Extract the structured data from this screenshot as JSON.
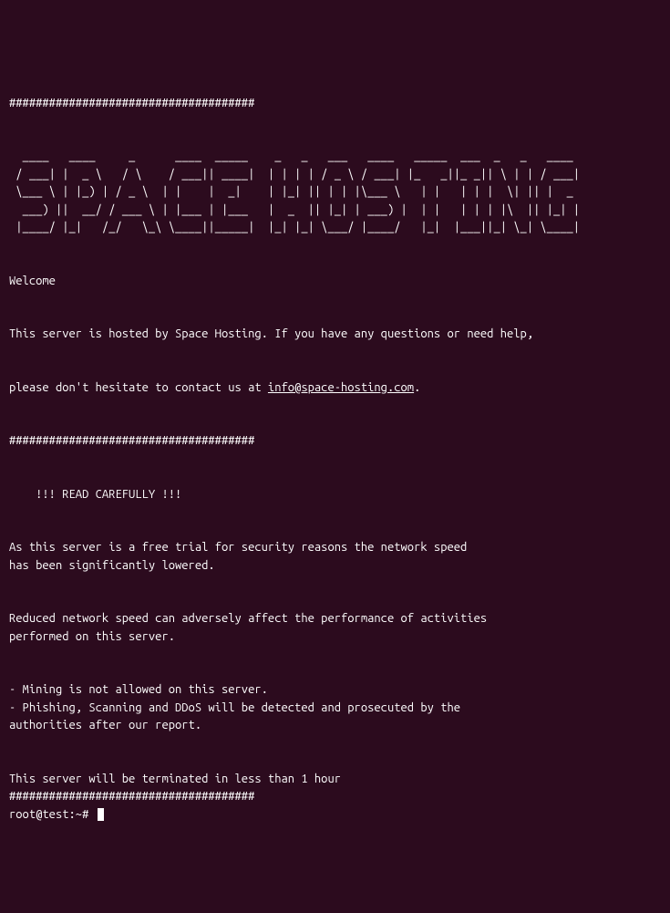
{
  "border_top": "#####################################",
  "ascii_art": "  ____   ____     _      ____  _____    _   _   ___   ____   _____  ___  _   _   ____\n / ___| |  _ \\   / \\    / ___|| ____|  | | | | / _ \\ / ___| |_   _||_ _|| \\ | | / ___|\n \\___ \\ | |_) | / _ \\  | |    |  _|    | |_| || | | |\\___ \\   | |   | | |  \\| || |  _\n  ___) ||  __/ / ___ \\ | |___ | |___   |  _  || |_| | ___) |  | |   | | | |\\  || |_| |\n |____/ |_|   /_/   \\_\\ \\____||_____|  |_| |_| \\___/ |____/   |_|  |___||_| \\_| \\____|",
  "welcome": "Welcome",
  "hosted_by": "This server is hosted by Space Hosting. If you have any questions or need help,",
  "contact_prefix": "please don't hesitate to contact us at ",
  "email": "info@space-hosting.com",
  "contact_suffix": ".",
  "border_mid": "#####################################",
  "read_carefully": "    !!! READ CAREFULLY !!!",
  "trial_line1": "As this server is a free trial for security reasons the network speed",
  "trial_line2": "has been significantly lowered.",
  "reduced_line1": "Reduced network speed can adversely affect the performance of activities",
  "reduced_line2": "performed on this server.",
  "rule1": "- Mining is not allowed on this server.",
  "rule2": "- Phishing, Scanning and DDoS will be detected and prosecuted by the",
  "rule3": "authorities after our report.",
  "termination": "This server will be terminated in less than 1 hour",
  "border_bottom": "#####################################",
  "prompt": "root@test:~# "
}
